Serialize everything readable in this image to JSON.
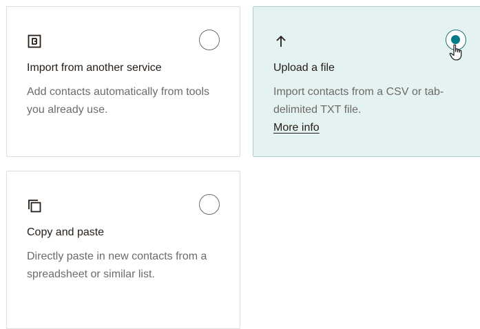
{
  "options": [
    {
      "id": "import",
      "icon": "integration-icon",
      "title": "Import from another service",
      "description": "Add contacts automatically from tools you already use.",
      "selected": false
    },
    {
      "id": "upload",
      "icon": "arrow-up-icon",
      "title": "Upload a file",
      "description": "Import contacts from a CSV or tab-delimited TXT file.",
      "link_label": "More info",
      "selected": true
    },
    {
      "id": "copy",
      "icon": "copy-paste-icon",
      "title": "Copy and paste",
      "description": "Directly paste in new contacts from a spreadsheet or similar list.",
      "selected": false
    }
  ],
  "colors": {
    "selected_background": "#e4f2f1",
    "radio_accent": "#007c89",
    "text_primary": "#241c15",
    "text_secondary": "#6e6a66"
  }
}
